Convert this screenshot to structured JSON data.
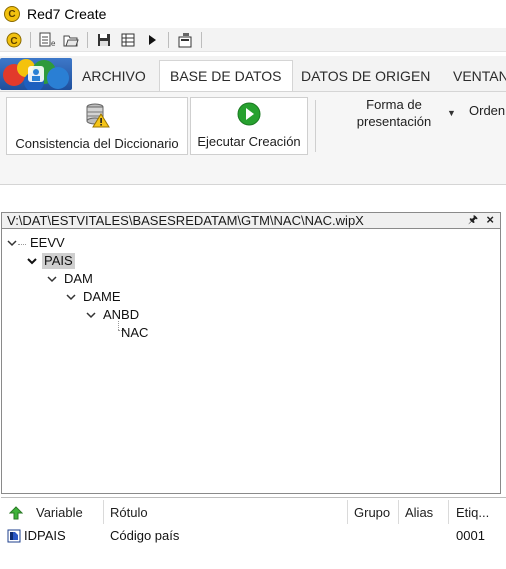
{
  "window": {
    "title": "Red7 Create",
    "logo_letter": "C"
  },
  "qat": {
    "icons": [
      "app-c-icon",
      "new-dictionary-icon",
      "open-folder-icon",
      "save-icon",
      "table-icon",
      "play-icon",
      "properties-icon"
    ]
  },
  "tabs": [
    {
      "label": "ARCHIVO",
      "active": false
    },
    {
      "label": "BASE DE DATOS",
      "active": true
    },
    {
      "label": "DATOS DE ORIGEN",
      "active": false
    },
    {
      "label": "VENTANA",
      "active": false
    }
  ],
  "ribbon": {
    "consistencia_label": "Consistencia del Diccionario",
    "ejecutar_label": "Ejecutar Creación",
    "forma_line1": "Forma de",
    "forma_line2": "presentación",
    "orden_label": "Orden"
  },
  "tree": {
    "path": "V:\\DAT\\ESTVITALES\\BASESREDATAM\\GTM\\NAC\\NAC.wipX",
    "nodes": [
      {
        "label": "EEVV",
        "selected": false
      },
      {
        "label": "PAIS",
        "selected": true
      },
      {
        "label": "DAM",
        "selected": false
      },
      {
        "label": "DAME",
        "selected": false
      },
      {
        "label": "ANBD",
        "selected": false
      },
      {
        "label": "NAC",
        "selected": false
      }
    ]
  },
  "variables": {
    "headers": {
      "variable": "Variable",
      "rotulo": "Rótulo",
      "grupo": "Grupo",
      "alias": "Alias",
      "etiq": "Etiq..."
    },
    "rows": [
      {
        "variable": "IDPAIS",
        "rotulo": "Código país",
        "grupo": "",
        "alias": "",
        "etiq": "0001"
      }
    ]
  },
  "colors": {
    "accent_blue": "#1f4f9c",
    "selection_gray": "#cfcfcf",
    "ribbon_bg": "#f6f6f6"
  }
}
